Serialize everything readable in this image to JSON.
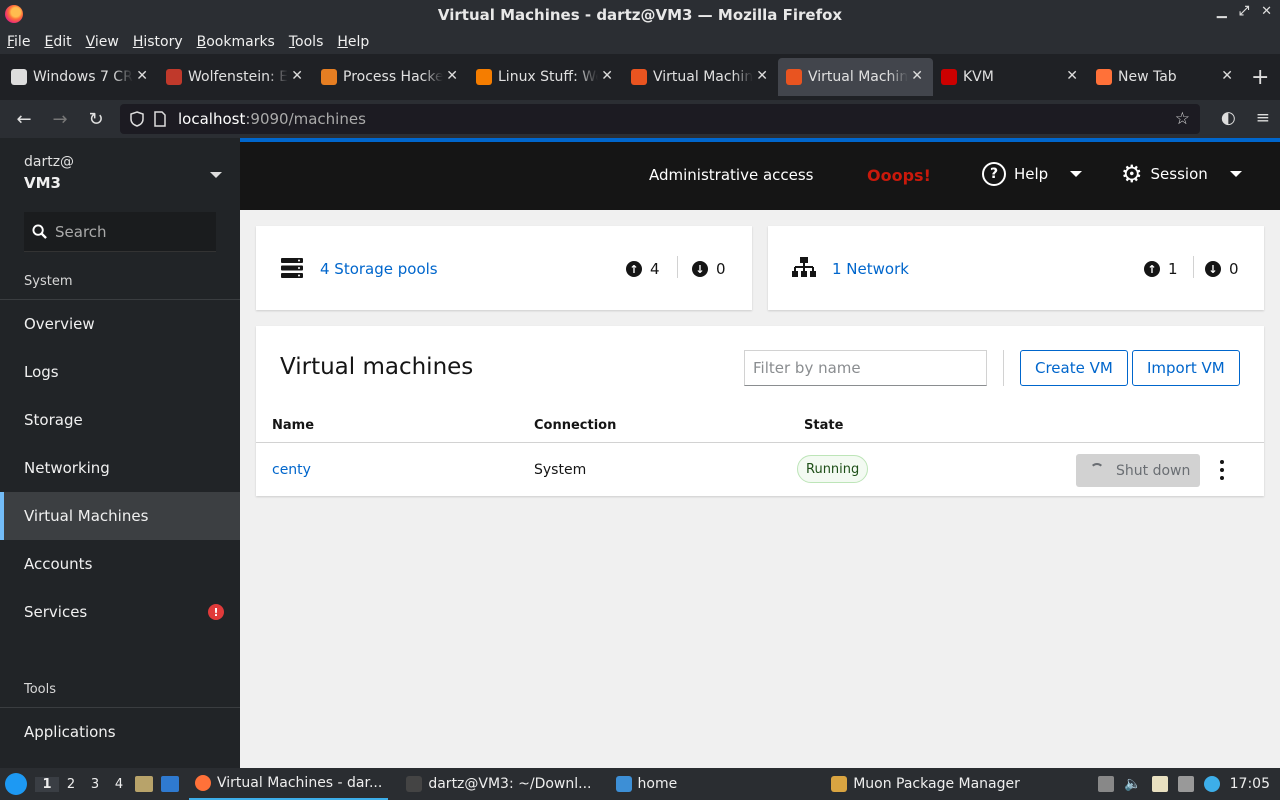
{
  "window": {
    "title": "Virtual Machines - dartz@VM3 — Mozilla Firefox"
  },
  "menubar": {
    "items": [
      {
        "label": "File",
        "u": "F",
        "rest": "ile"
      },
      {
        "label": "Edit",
        "u": "E",
        "rest": "dit"
      },
      {
        "label": "View",
        "u": "V",
        "rest": "iew"
      },
      {
        "label": "History",
        "u": "H",
        "rest": "istory"
      },
      {
        "label": "Bookmarks",
        "u": "B",
        "rest": "ookmarks"
      },
      {
        "label": "Tools",
        "u": "T",
        "rest": "ools"
      },
      {
        "label": "Help",
        "u": "H",
        "rest": "elp"
      }
    ]
  },
  "tabs": [
    {
      "label": "Windows 7 CR",
      "color": "#dddddd",
      "active": false
    },
    {
      "label": "Wolfenstein: E",
      "color": "#c0392b",
      "active": false
    },
    {
      "label": "Process Hacke",
      "color": "#e67e22",
      "active": false
    },
    {
      "label": "Linux Stuff: We",
      "color": "#f57d00",
      "active": false
    },
    {
      "label": "Virtual Machin",
      "color": "#e95420",
      "active": false
    },
    {
      "label": "Virtual Machin",
      "color": "#e95420",
      "active": true
    },
    {
      "label": "KVM",
      "color": "#cc0000",
      "active": false
    },
    {
      "label": "New Tab",
      "color": "#ff7139",
      "active": false
    }
  ],
  "url": {
    "host": "localhost",
    "path": ":9090/machines"
  },
  "sidebar": {
    "user": "dartz@",
    "host": "VM3",
    "search_placeholder": "Search",
    "section_system": "System",
    "items": [
      {
        "label": "Overview",
        "active": false,
        "alert": false
      },
      {
        "label": "Logs",
        "active": false,
        "alert": false
      },
      {
        "label": "Storage",
        "active": false,
        "alert": false
      },
      {
        "label": "Networking",
        "active": false,
        "alert": false
      },
      {
        "label": "Virtual Machines",
        "active": true,
        "alert": false
      },
      {
        "label": "Accounts",
        "active": false,
        "alert": false
      },
      {
        "label": "Services",
        "active": false,
        "alert": true
      }
    ],
    "alert_glyph": "!",
    "section_tools": "Tools",
    "tools_items": [
      {
        "label": "Applications"
      }
    ]
  },
  "masthead": {
    "admin": "Administrative access",
    "ooops": "Ooops!",
    "help": "Help",
    "session": "Session",
    "accent": "#0066cc"
  },
  "storage_card": {
    "link": "4 Storage pools",
    "up": "4",
    "down": "0"
  },
  "network_card": {
    "link": "1 Network",
    "up": "1",
    "down": "0"
  },
  "vms": {
    "title": "Virtual machines",
    "filter_placeholder": "Filter by name",
    "create_label": "Create VM",
    "import_label": "Import VM",
    "columns": {
      "name": "Name",
      "connection": "Connection",
      "state": "State"
    },
    "rows": [
      {
        "name": "centy",
        "connection": "System",
        "state": "Running",
        "action": "Shut down"
      }
    ]
  },
  "taskbar": {
    "workspaces": [
      "1",
      "2",
      "3",
      "4"
    ],
    "tasks": [
      {
        "label": "Virtual Machines - dar...",
        "icon": "firefox-icon",
        "active": true
      },
      {
        "label": "dartz@VM3: ~/Downl...",
        "icon": "terminal-icon",
        "active": false
      },
      {
        "label": "home",
        "icon": "folder-icon",
        "active": false
      },
      {
        "label": "Muon Package Manager",
        "icon": "package-icon",
        "active": false
      }
    ],
    "clock": "17:05"
  }
}
